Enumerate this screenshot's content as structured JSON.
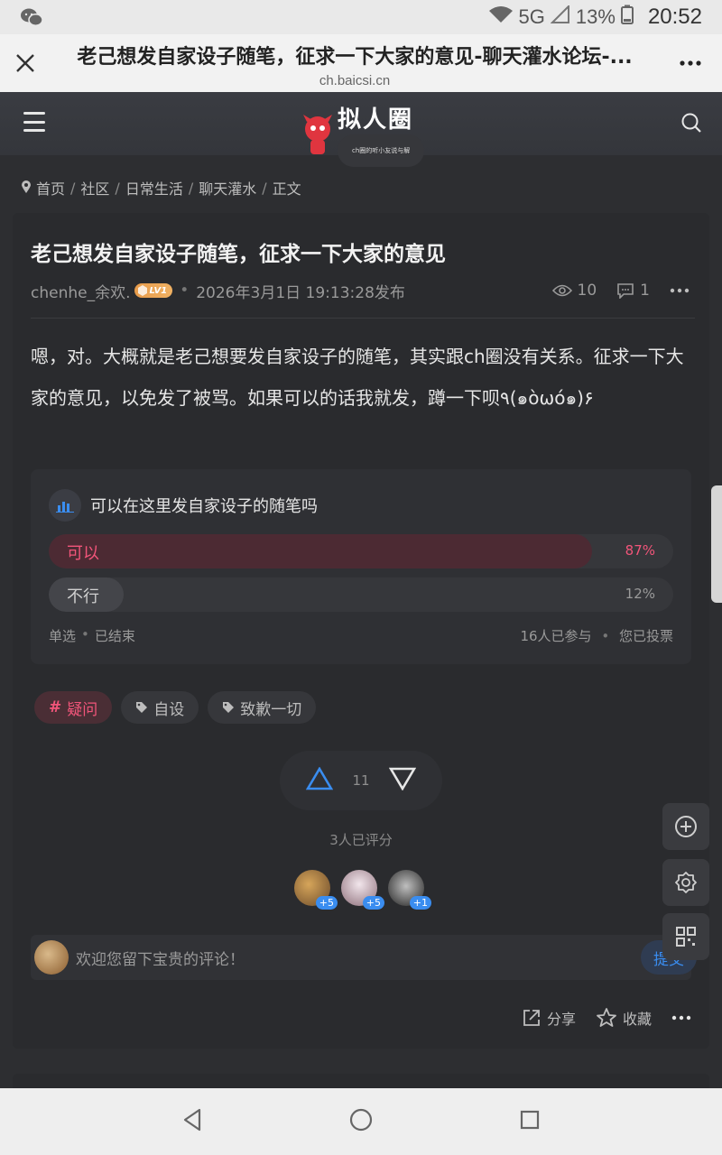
{
  "status_bar": {
    "network": "5G",
    "battery": "13%",
    "time": "20:52"
  },
  "browser": {
    "title": "老己想发自家设子随笔，征求一下大家的意见-聊天灌水论坛-...",
    "domain": "ch.baicsi.cn"
  },
  "site": {
    "logo_text": "拟人圈",
    "logo_tagline": "ch圈的听小友说与解"
  },
  "breadcrumb": [
    "首页",
    "社区",
    "日常生活",
    "聊天灌水",
    "正文"
  ],
  "post": {
    "title": "老己想发自家设子随笔，征求一下大家的意见",
    "author": "chenhe_余欢.",
    "level": "LV1",
    "published": "2026年3月1日 19:13:28发布",
    "views": "10",
    "comments": "1",
    "content": "嗯，对。大概就是老己想要发自家设子的随笔，其实跟ch圈没有关系。征求一下大家的意见，以免发了被骂。如果可以的话我就发，蹲一下呗٩(๑òωó๑)۶"
  },
  "poll": {
    "question": "可以在这里发自家设子的随笔吗",
    "options": [
      {
        "label": "可以",
        "pct_text": "87%",
        "pct": 87
      },
      {
        "label": "不行",
        "pct_text": "12%",
        "pct": 12
      }
    ],
    "type": "单选",
    "status": "已结束",
    "participants": "16人已参与",
    "voted": "您已投票"
  },
  "tags": [
    "疑问",
    "自设",
    "致歉一切"
  ],
  "rating": {
    "score": "11",
    "rated_text": "3人已评分",
    "raters": [
      {
        "badge": "+5"
      },
      {
        "badge": "+5"
      },
      {
        "badge": "+1"
      }
    ]
  },
  "comment": {
    "placeholder": "欢迎您留下宝贵的评论！",
    "submit": "提交"
  },
  "actions": {
    "share": "分享",
    "favorite": "收藏"
  },
  "colors": {
    "accent_blue": "#3a8df0",
    "accent_red": "#f2557a",
    "card_bg": "#2a2b2e"
  }
}
